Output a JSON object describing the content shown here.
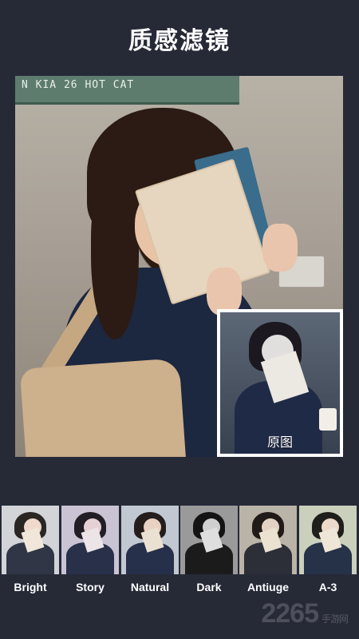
{
  "header": {
    "title": "质感滤镜"
  },
  "photo": {
    "sign_text": "N KIA 26 HOT CAT"
  },
  "original_preview": {
    "label": "原图"
  },
  "filters": [
    {
      "label": "Bright",
      "tint": "#cfd1d6"
    },
    {
      "label": "Story",
      "tint": "#c7c0cf"
    },
    {
      "label": "Natural",
      "tint": "#bcc4cf"
    },
    {
      "label": "Dark",
      "tint": "#8d8d8d"
    },
    {
      "label": "Antiuge",
      "tint": "#b5aea3"
    },
    {
      "label": "A-3",
      "tint": "#c8cdb9"
    }
  ],
  "watermark": {
    "text": "2265",
    "suffix": "手游网"
  }
}
